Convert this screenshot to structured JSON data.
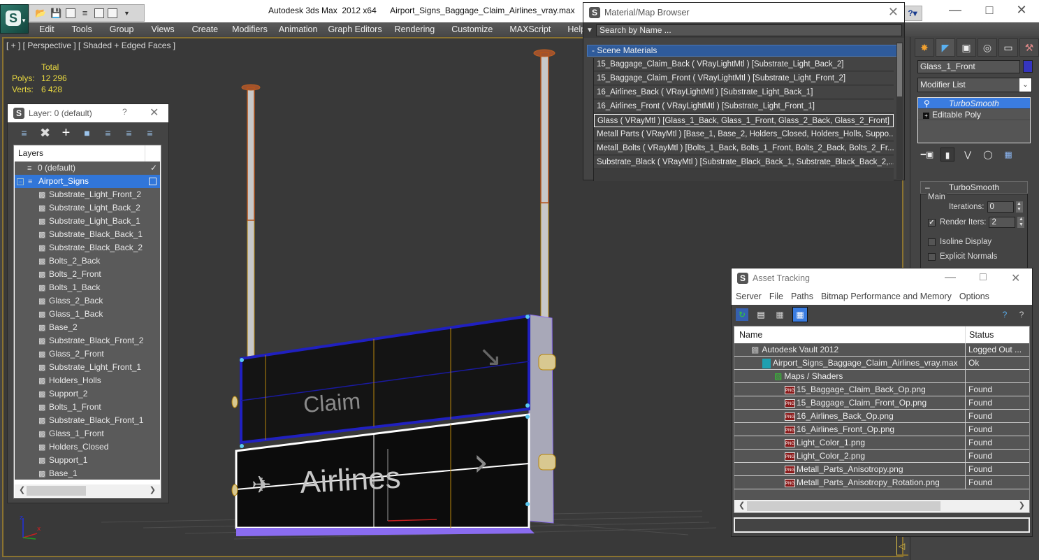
{
  "app": {
    "product": "Autodesk 3ds Max  2012 x64",
    "file": "Airport_Signs_Baggage_Claim_Airlines_vray.max",
    "quick_access": [
      "open-icon",
      "save-icon",
      "window-icon",
      "project-icon",
      "window-icon",
      "window-icon",
      "dropdown-icon"
    ]
  },
  "menu": [
    "Edit",
    "Tools",
    "Group",
    "Views",
    "Create",
    "Modifiers",
    "Animation",
    "Graph Editors",
    "Rendering",
    "Customize",
    "MAXScript",
    "Help"
  ],
  "viewport": {
    "label": "[ + ] [ Perspective ] [ Shaded + Edged Faces ]",
    "stats": {
      "header": "Total",
      "polys_label": "Polys:",
      "polys": "12 296",
      "verts_label": "Verts:",
      "verts": "6 428"
    },
    "sign_top_text": "Claim",
    "sign_bottom_text": "Airlines",
    "axis": {
      "z": "z",
      "x": "x",
      "y": "y"
    }
  },
  "layer_panel": {
    "title": "Layer: 0 (default)",
    "help": "?",
    "column": "Layers",
    "default_layer": "0 (default)",
    "selected_layer": "Airport_Signs",
    "objects": [
      "Substrate_Light_Front_2",
      "Substrate_Light_Back_2",
      "Substrate_Light_Back_1",
      "Substrate_Black_Back_1",
      "Substrate_Black_Back_2",
      "Bolts_2_Back",
      "Bolts_2_Front",
      "Bolts_1_Back",
      "Glass_2_Back",
      "Glass_1_Back",
      "Base_2",
      "Substrate_Black_Front_2",
      "Glass_2_Front",
      "Substrate_Light_Front_1",
      "Holders_Holls",
      "Support_2",
      "Bolts_1_Front",
      "Substrate_Black_Front_1",
      "Glass_1_Front",
      "Holders_Closed",
      "Support_1",
      "Base_1"
    ]
  },
  "material_browser": {
    "title": "Material/Map Browser",
    "search_placeholder": "Search by Name ...",
    "group": "- Scene Materials",
    "materials": [
      "15_Baggage_Claim_Back ( VRayLightMtl ) [Substrate_Light_Back_2]",
      "15_Baggage_Claim_Front ( VRayLightMtl ) [Substrate_Light_Front_2]",
      "16_Airlines_Back  ( VRayLightMtl )  [Substrate_Light_Back_1]",
      "16_Airlines_Front  ( VRayLightMtl )  [Substrate_Light_Front_1]",
      "Glass  ( VRayMtl ) [Glass_1_Back, Glass_1_Front, Glass_2_Back, Glass_2_Front]",
      "Metall Parts  ( VRayMtl ) [Base_1, Base_2, Holders_Closed, Holders_Holls, Suppo...",
      "Metall_Bolts  ( VRayMtl ) [Bolts_1_Back, Bolts_1_Front, Bolts_2_Back, Bolts_2_Fr...",
      "Substrate_Black  ( VRayMtl )  [Substrate_Black_Back_1, Substrate_Black_Back_2,..."
    ],
    "selected_index": 4
  },
  "command_panel": {
    "object_name": "Glass_1_Front",
    "object_color": "#3535c0",
    "modifier_list": "Modifier List",
    "stack": [
      "TurboSmooth",
      "Editable Poly"
    ],
    "rollout": "TurboSmooth",
    "group": "Main",
    "iterations_label": "Iterations:",
    "iterations": "0",
    "render_iters_label": "Render Iters:",
    "render_iters": "2",
    "render_iters_checked": true,
    "isoline_label": "Isoline Display",
    "isoline_checked": false,
    "explicit_normals_label": "Explicit Normals",
    "explicit_normals_checked": false
  },
  "asset_tracking": {
    "title": "Asset Tracking",
    "menu": [
      "Server",
      "File",
      "Paths",
      "Bitmap Performance and Memory",
      "Options"
    ],
    "columns": [
      "Name",
      "Status"
    ],
    "rows": [
      {
        "name": "Autodesk Vault 2012",
        "status": "Logged Out ...",
        "indent": 1,
        "icon": "vault-icon"
      },
      {
        "name": "Airport_Signs_Baggage_Claim_Airlines_vray.max",
        "status": "Ok",
        "indent": 2,
        "icon": "max-file-icon"
      },
      {
        "name": "Maps / Shaders",
        "status": "",
        "indent": 3,
        "icon": "maps-icon"
      },
      {
        "name": "15_Baggage_Claim_Back_Op.png",
        "status": "Found",
        "indent": 4,
        "icon": "png-icon"
      },
      {
        "name": "15_Baggage_Claim_Front_Op.png",
        "status": "Found",
        "indent": 4,
        "icon": "png-icon"
      },
      {
        "name": "16_Airlines_Back_Op.png",
        "status": "Found",
        "indent": 4,
        "icon": "png-icon"
      },
      {
        "name": "16_Airlines_Front_Op.png",
        "status": "Found",
        "indent": 4,
        "icon": "png-icon"
      },
      {
        "name": "Light_Color_1.png",
        "status": "Found",
        "indent": 4,
        "icon": "png-icon"
      },
      {
        "name": "Light_Color_2.png",
        "status": "Found",
        "indent": 4,
        "icon": "png-icon"
      },
      {
        "name": "Metall_Parts_Anisotropy.png",
        "status": "Found",
        "indent": 4,
        "icon": "png-icon"
      },
      {
        "name": "Metall_Parts_Anisotropy_Rotation.png",
        "status": "Found",
        "indent": 4,
        "icon": "png-icon"
      }
    ],
    "path_field": ""
  },
  "colors": {
    "selection_blue": "#3176d9",
    "stats_yellow": "#e8d840",
    "viewport_border": "#8b7330"
  }
}
